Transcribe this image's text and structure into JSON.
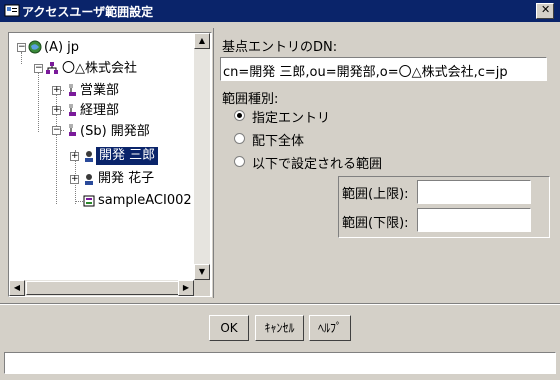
{
  "window": {
    "title": "アクセスユーザ範囲設定",
    "close_glyph": "✕"
  },
  "tree": {
    "root": "(A) jp",
    "org": "〇△株式会社",
    "dept_sales": "営業部",
    "dept_accounting": "経理部",
    "dept_dev": "(Sb) 開発部",
    "user_saburo": "開発 三郎",
    "user_hanako": "開発 花子",
    "acl": "sampleACI002",
    "expander_minus": "−",
    "expander_plus": "+"
  },
  "form": {
    "dn_label": "基点エントリのDN:",
    "dn_value": "cn=開発 三郎,ou=開発部,o=〇△株式会社,c=jp",
    "scope_label": "範囲種別:",
    "scope_options": [
      "指定エントリ",
      "配下全体",
      "以下で設定される範囲"
    ],
    "scope_selected": "指定エントリ",
    "upper_label": "範囲(上限):",
    "lower_label": "範囲(下限):",
    "upper_value": "",
    "lower_value": ""
  },
  "buttons": {
    "ok": "OK",
    "cancel": "ｷｬﾝｾﾙ",
    "help": "ﾍﾙﾌﾟ"
  },
  "status": {
    "text": ""
  }
}
